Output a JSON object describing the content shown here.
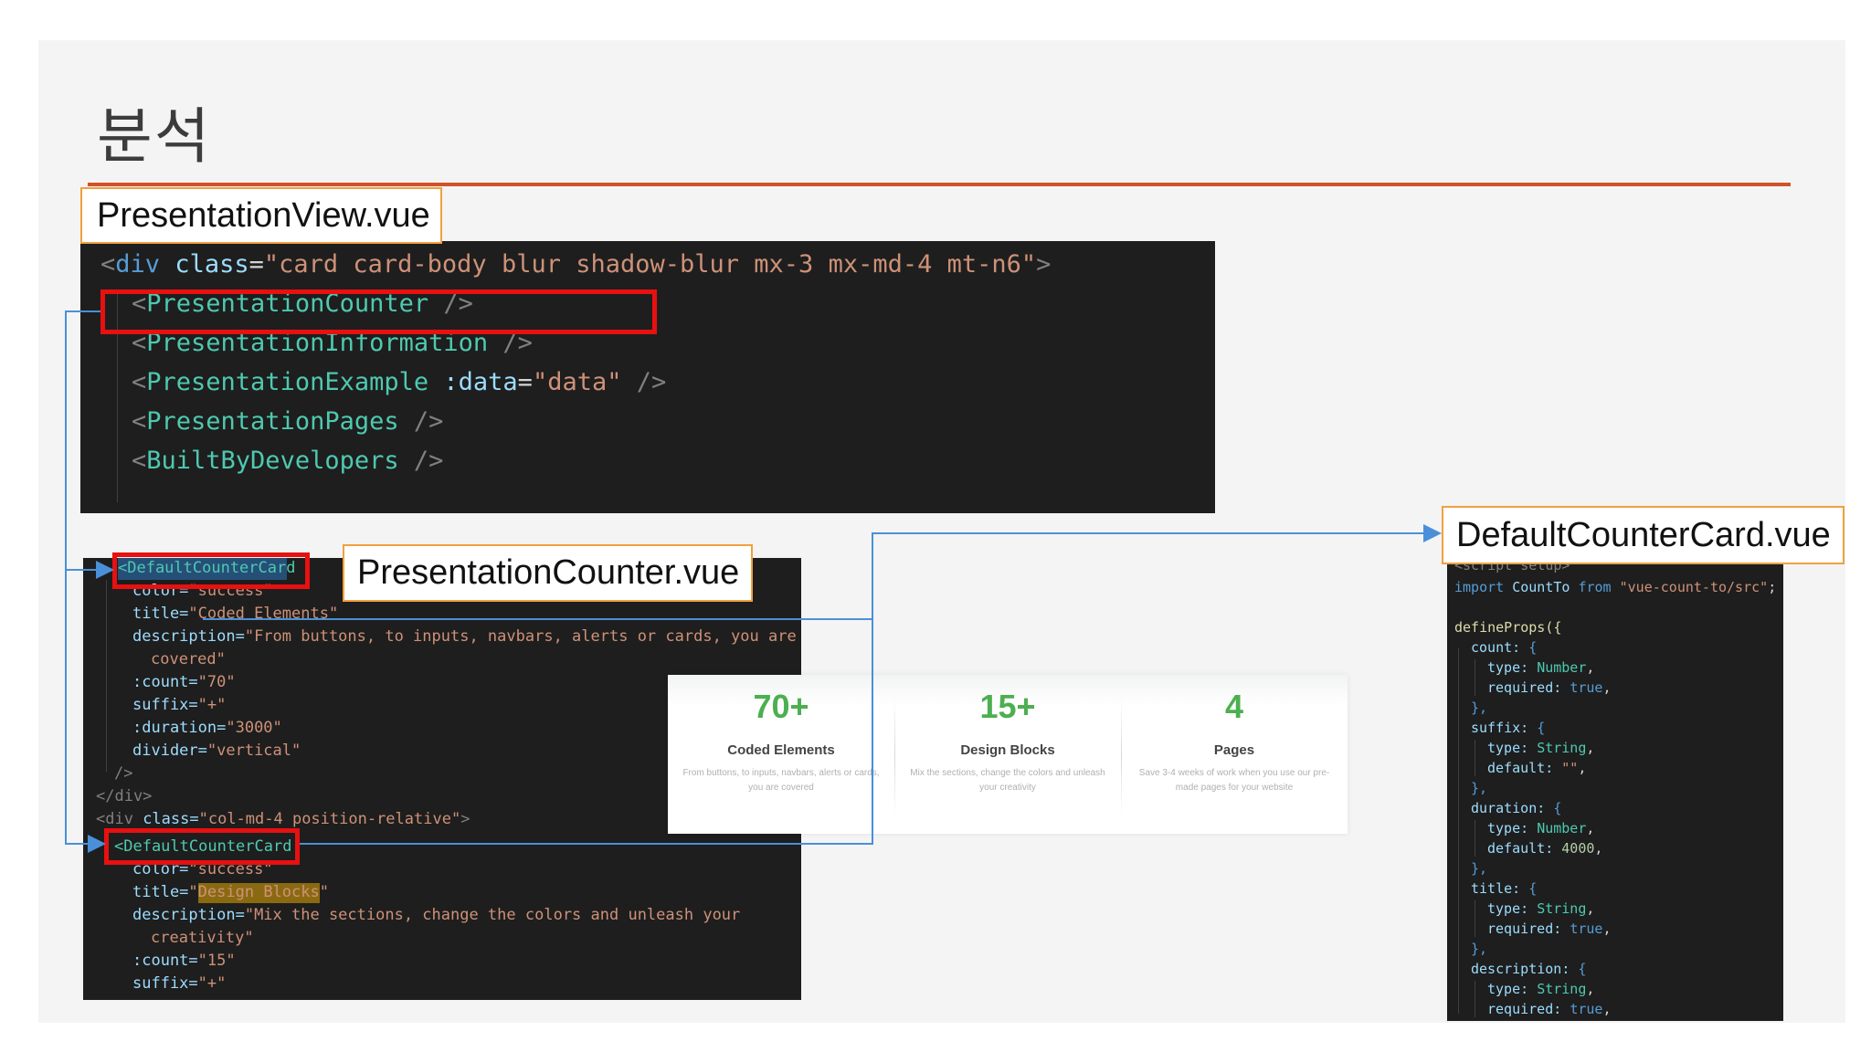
{
  "slide": {
    "title": "분석",
    "accent_color": "#d05226"
  },
  "labels": {
    "presentation_view": "PresentationView.vue",
    "presentation_counter": "PresentationCounter.vue",
    "default_counter_card": "DefaultCounterCard.vue"
  },
  "code_view": {
    "line1": {
      "open": "<",
      "tag": "div",
      "attr": "class",
      "eq": "=",
      "value": "\"card card-body blur shadow-blur mx-3 mx-md-4 mt-n6\"",
      "close": ">"
    },
    "line2": {
      "open": "<",
      "tag": "PresentationCounter",
      "close": " />"
    },
    "line3": {
      "open": "<",
      "tag": "PresentationInformation",
      "close": " />"
    },
    "line4": {
      "open": "<",
      "tag": "PresentationExample",
      "attr": ":data",
      "eq": "=",
      "value": "\"data\"",
      "close": " />"
    },
    "line5": {
      "open": "<",
      "tag": "PresentationPages",
      "close": " />"
    },
    "line6": {
      "open": "<",
      "tag": "BuiltByDevelopers",
      "close": " />"
    }
  },
  "code_counter": {
    "l1": "<DefaultCounterCard",
    "l2a": "color=",
    "l2b": "\"success\"",
    "l3a": "title=",
    "l3b": "\"Coded Elements\"",
    "l4a": "description=",
    "l4b": "\"From buttons, to inputs, navbars, alerts or cards, you are",
    "l5": "covered\"",
    "l6a": ":count=",
    "l6b": "\"70\"",
    "l7a": "suffix=",
    "l7b": "\"+\"",
    "l8a": ":duration=",
    "l8b": "\"3000\"",
    "l9a": "divider=",
    "l9b": "\"vertical\"",
    "l10": "/>",
    "l11": "</div>",
    "l12a": "<div ",
    "l12b": "class=",
    "l12c": "\"col-md-4 position-relative\"",
    "l12d": ">",
    "l13": "<DefaultCounterCard",
    "l14a": "color=",
    "l14b": "\"success\"",
    "l15a": "title=",
    "l15b": "\"",
    "l15c": "Design Blocks",
    "l15d": "\"",
    "l16a": "description=",
    "l16b": "\"Mix the sections, change the colors and unleash your",
    "l17": "creativity\"",
    "l18a": ":count=",
    "l18b": "\"15\"",
    "l19a": "suffix=",
    "l19b": "\"+\""
  },
  "code_card": {
    "l0": "<script setup>",
    "l1a": "import ",
    "l1b": "CountTo ",
    "l1c": "from ",
    "l1d": "\"vue-count-to/src\"",
    "l1e": ";",
    "l2": "defineProps({",
    "l3a": "count: ",
    "l3b": "{",
    "l4a": "type: ",
    "l4b": "Number",
    "l4c": ",",
    "l5a": "required: ",
    "l5b": "true",
    "l5c": ",",
    "l6": "},",
    "l7a": "suffix: ",
    "l7b": "{",
    "l8a": "type: ",
    "l8b": "String",
    "l8c": ",",
    "l9a": "default: ",
    "l9b": "\"\"",
    "l9c": ",",
    "l10": "},",
    "l11a": "duration: ",
    "l11b": "{",
    "l12a": "type: ",
    "l12b": "Number",
    "l12c": ",",
    "l13a": "default: ",
    "l13b": "4000",
    "l13c": ",",
    "l14": "},",
    "l15a": "title: ",
    "l15b": "{",
    "l16a": "type: ",
    "l16b": "String",
    "l16c": ",",
    "l17a": "required: ",
    "l17b": "true",
    "l17c": ",",
    "l18": "},",
    "l19a": "description: ",
    "l19b": "{",
    "l20a": "type: ",
    "l20b": "String",
    "l20c": ",",
    "l21a": "required: ",
    "l21b": "true",
    "l21c": ","
  },
  "stats": [
    {
      "count": "70+",
      "title": "Coded Elements",
      "description": "From buttons, to inputs, navbars, alerts or cards, you are covered"
    },
    {
      "count": "15+",
      "title": "Design Blocks",
      "description": "Mix the sections, change the colors and unleash your creativity"
    },
    {
      "count": "4",
      "title": "Pages",
      "description": "Save 3-4 weeks of work when you use our pre-made pages for your website"
    }
  ],
  "colors": {
    "highlight_box": "#e81010",
    "label_border": "#f0a040",
    "connector": "#4a90d9",
    "counter_green": "#4caf50"
  }
}
